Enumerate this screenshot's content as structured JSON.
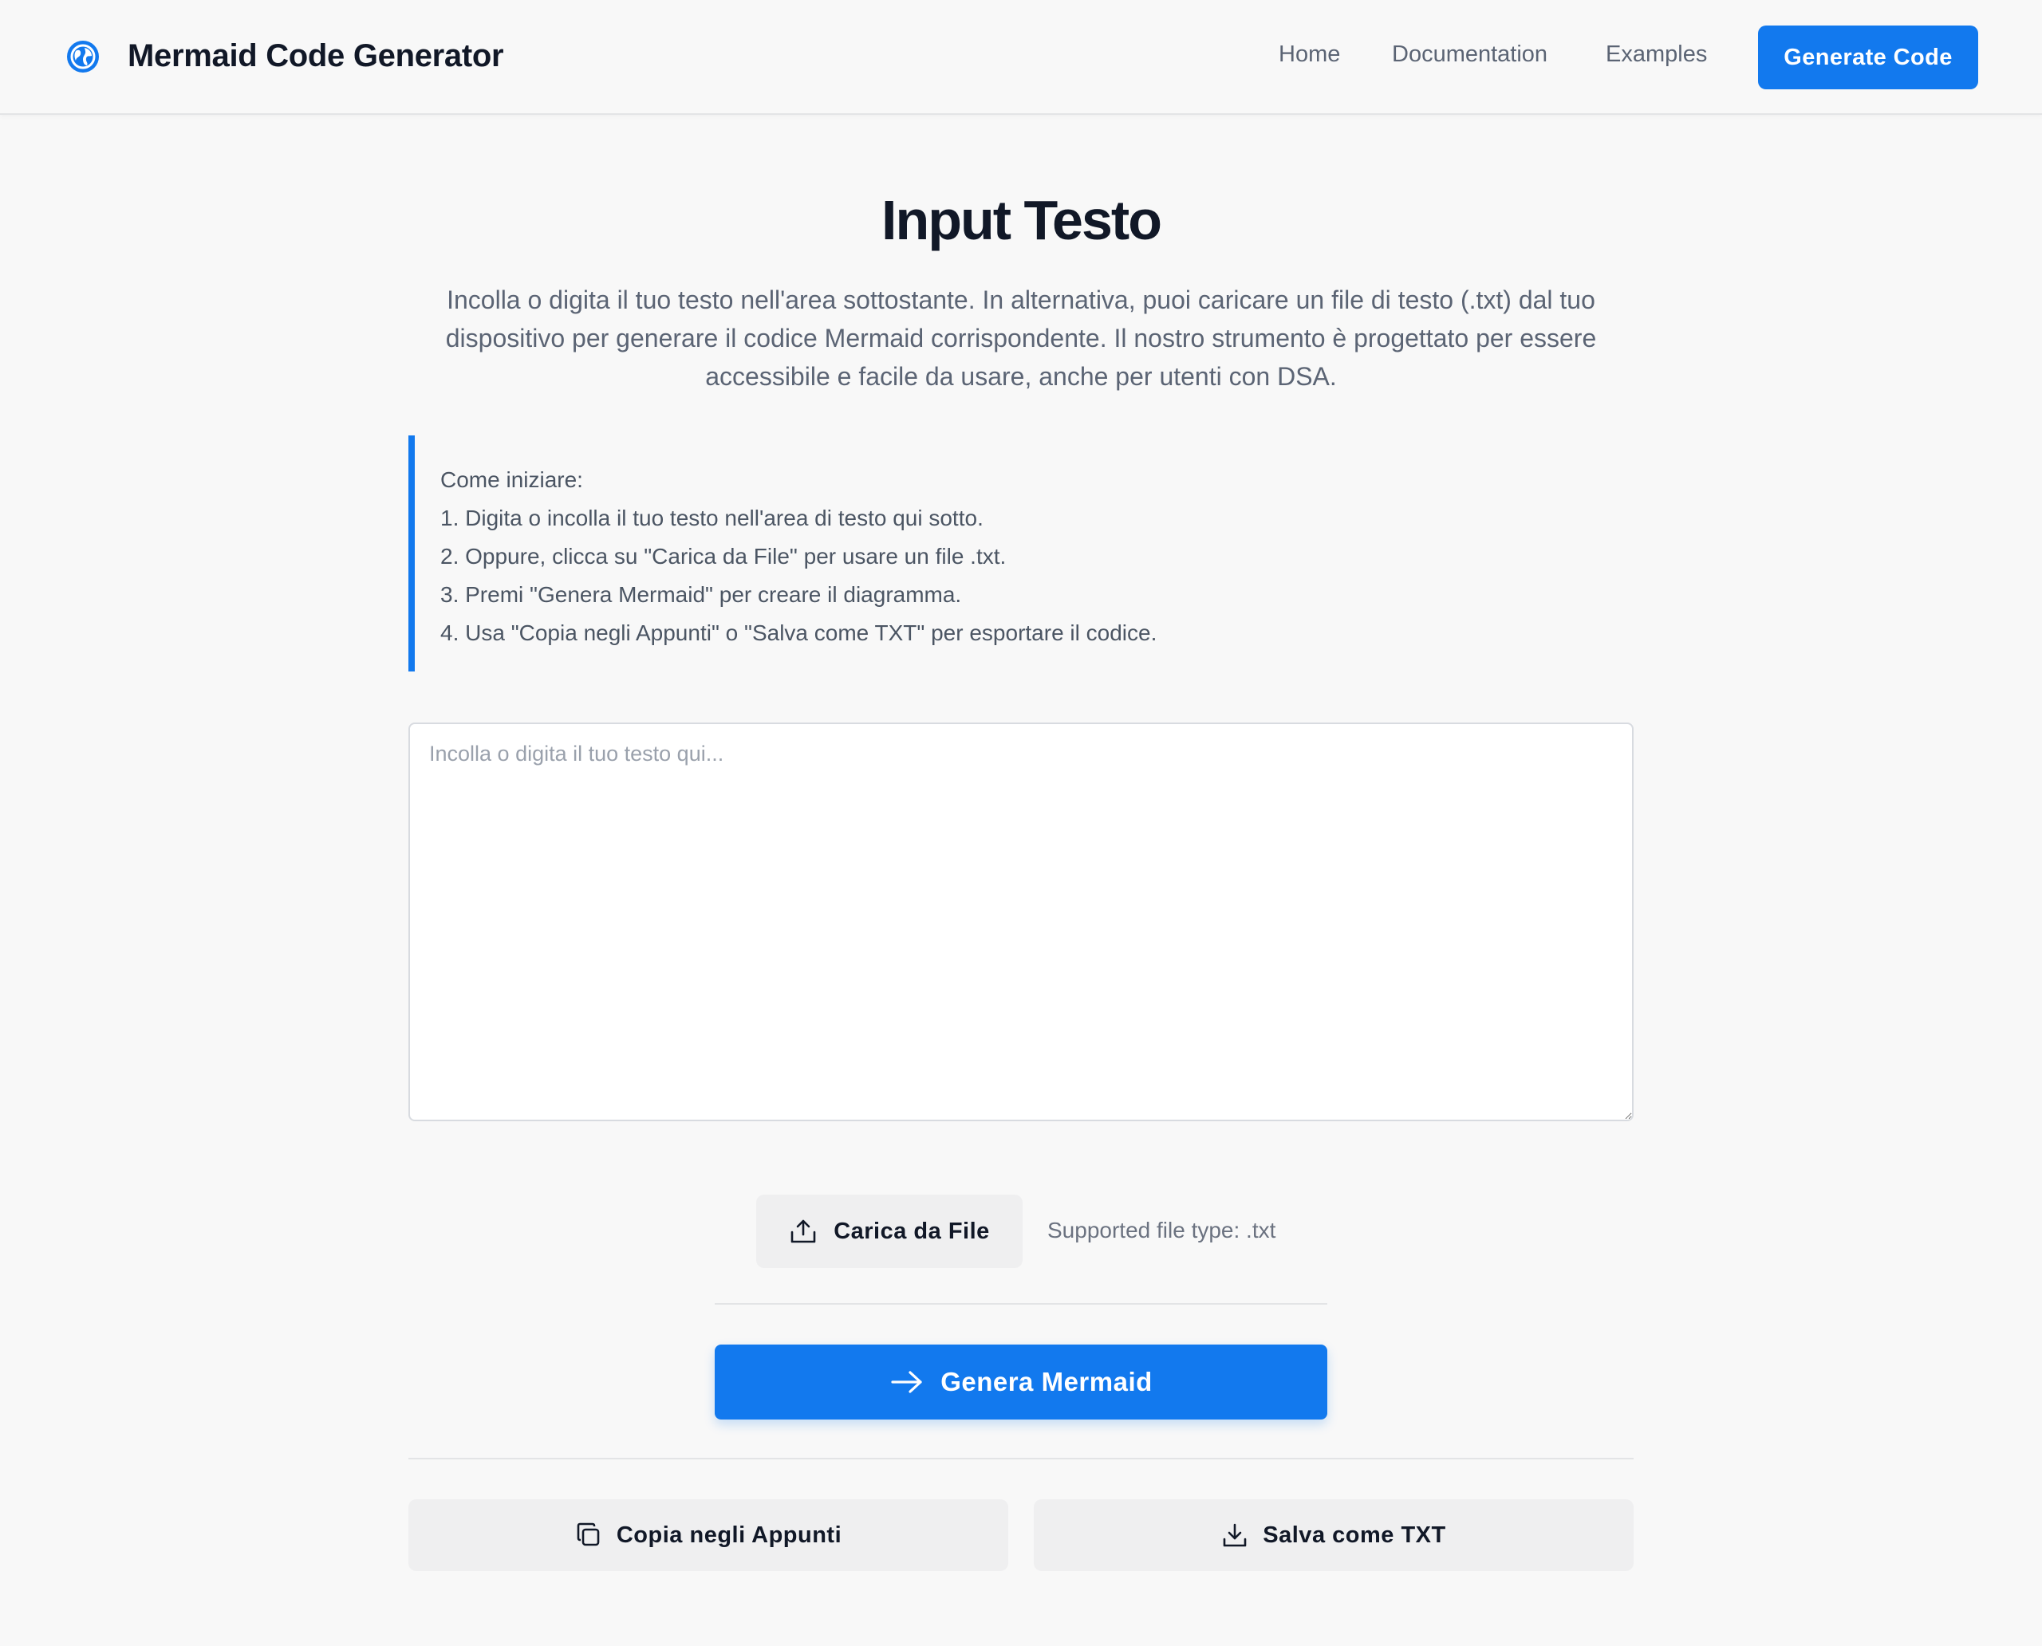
{
  "header": {
    "brand_icon": "globe-icon",
    "brand_title": "Mermaid Code Generator",
    "nav": [
      {
        "label": "Home"
      },
      {
        "label": "Documentation"
      },
      {
        "label": "Examples"
      }
    ],
    "cta_label": "Generate Code",
    "accent_color": "#1279ee"
  },
  "main": {
    "title": "Input Testo",
    "intro": "Incolla o digita il tuo testo nell'area sottostante. In alternativa, puoi caricare un file di testo (.txt) dal tuo dispositivo per generare il codice Mermaid corrispondente. Il nostro strumento è progettato per essere accessibile e facile da usare, anche per utenti con DSA.",
    "howto": {
      "heading": "Come iniziare:",
      "steps": [
        "1. Digita o incolla il tuo testo nell'area di testo qui sotto.",
        "2. Oppure, clicca su \"Carica da File\" per usare un file .txt.",
        "3. Premi \"Genera Mermaid\" per creare il diagramma.",
        "4. Usa \"Copia negli Appunti\" o \"Salva come TXT\" per esportare il codice."
      ]
    },
    "textarea": {
      "value": "",
      "placeholder": "Incolla o digita il tuo testo qui..."
    },
    "upload": {
      "icon": "upload-icon",
      "label": "Carica da File",
      "hint": "Supported file type: .txt"
    },
    "generate": {
      "icon": "arrow-right-icon",
      "label": "Genera Mermaid"
    },
    "actions": {
      "copy": {
        "icon": "copy-icon",
        "label": "Copia negli Appunti"
      },
      "save": {
        "icon": "download-icon",
        "label": "Salva come TXT"
      }
    }
  }
}
